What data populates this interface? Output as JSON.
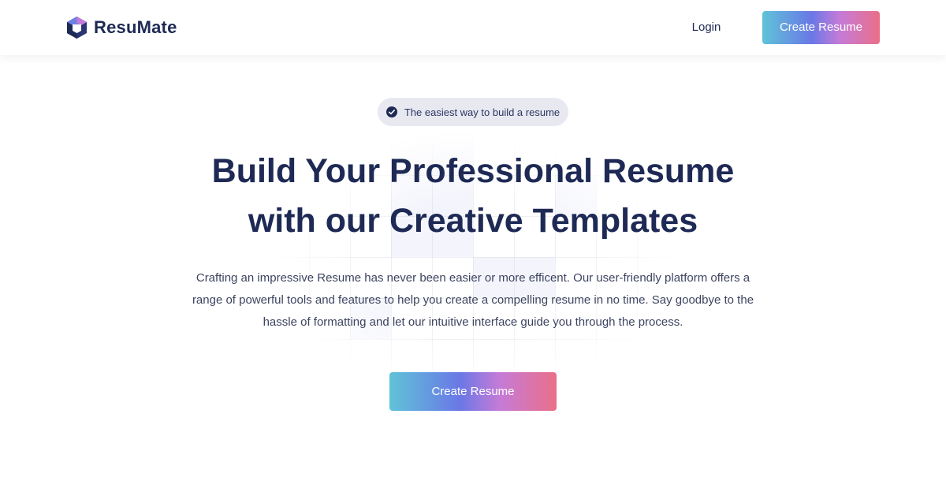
{
  "header": {
    "brand": "ResuMate",
    "login_label": "Login",
    "cta_label": "Create Resume"
  },
  "hero": {
    "badge_text": "The easiest way to build a resume",
    "title_line1": "Build Your Professional Resume",
    "title_line2": "with our Creative Templates",
    "description": "Crafting an impressive Resume has never been easier or more efficent. Our user-friendly platform offers a range of powerful tools and features to help you create a compelling resume in no time. Say goodbye to the hassle of formatting and let our intuitive interface guide you through the process.",
    "cta_label": "Create Resume"
  },
  "icons": {
    "logo": "hexagon-cube-logo-icon",
    "badge": "check-circle-icon"
  },
  "colors": {
    "brand_dark": "#1e2a55",
    "gradient": [
      "#5fc3d8",
      "#6a78e6",
      "#c57bd7",
      "#ea6f89"
    ],
    "badge_bg": "#e8e9f0"
  }
}
